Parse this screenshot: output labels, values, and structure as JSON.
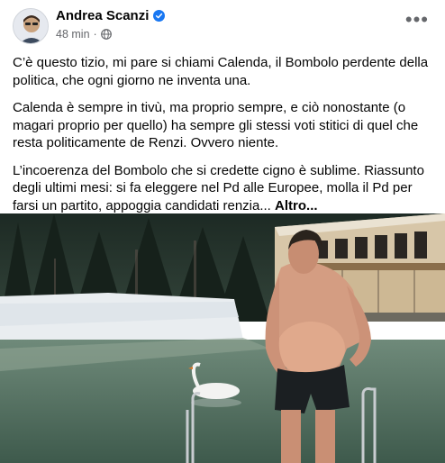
{
  "post": {
    "author": "Andrea Scanzi",
    "time": "48 min",
    "separator": "·",
    "paragraphs": [
      "C’è questo tizio, mi pare si chiami Calenda, il Bombolo perdente della politica, che ogni giorno ne inventa una.",
      "Calenda è sempre in tivù, ma proprio sempre, e ciò nonostante (o magari proprio per quello) ha sempre gli stessi voti stitici di quel che resta politicamente de Renzi. Ovvero niente.",
      "L’incoerenza del Bombolo che si credette cigno è sublime. Riassunto degli ultimi mesi: si fa eleggere nel Pd alle Europee, molla il Pd per farsi un partito, appoggia candidati renzia..."
    ],
    "see_more": "Altro...",
    "icons": [
      "verified-badge",
      "globe-icon",
      "more-options-icon"
    ],
    "colors": {
      "verified": "#1877f2",
      "meta": "#65676b"
    }
  }
}
